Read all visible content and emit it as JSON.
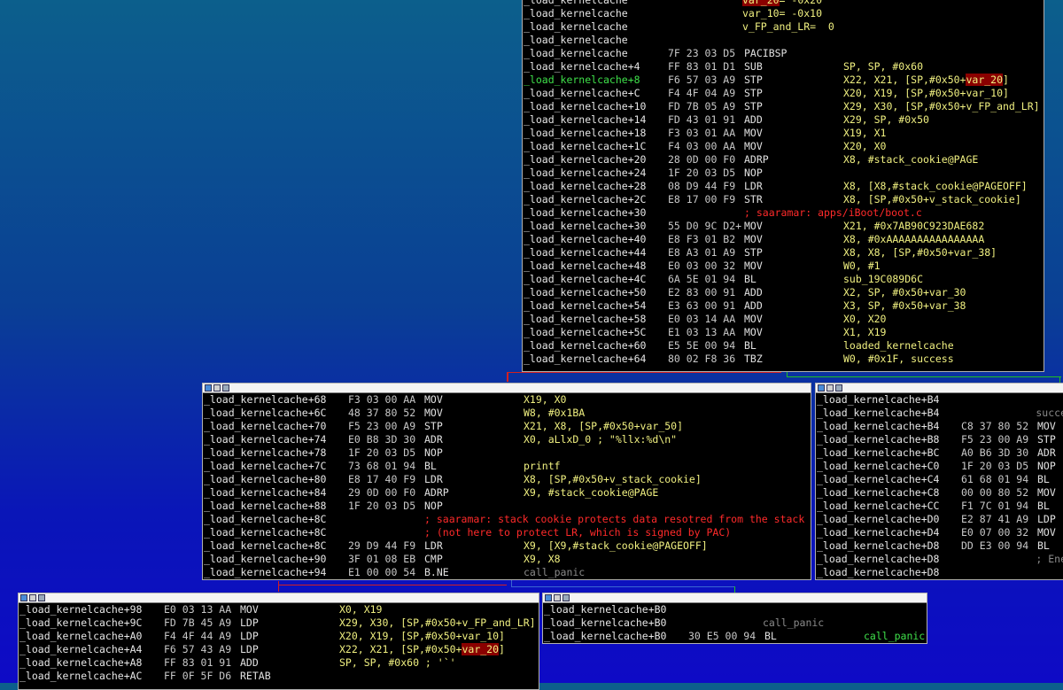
{
  "nodes": [
    {
      "id": "node-top",
      "title": false,
      "lines": [
        {
          "label": "_load_kernelcache",
          "hex": "",
          "mn": "",
          "ops": "var_20= -0x20",
          "cls": "op"
        },
        {
          "label": "_load_kernelcache",
          "hex": "",
          "mn": "",
          "ops": "var_10= -0x10",
          "cls": "op"
        },
        {
          "label": "_load_kernelcache",
          "hex": "",
          "mn": "",
          "ops": "v_FP_and_LR=  0",
          "cls": "op"
        },
        {
          "label": "_load_kernelcache",
          "hex": "",
          "mn": "",
          "ops": ""
        },
        {
          "label": "_load_kernelcache",
          "hex": "7F 23 03 D5",
          "mn": "PACIBSP",
          "ops": ""
        },
        {
          "label": "_load_kernelcache+4",
          "hex": "FF 83 01 D1",
          "mn": "SUB",
          "ops": "SP, SP, #0x60"
        },
        {
          "label": "_load_kernelcache+8",
          "hex": "F6 57 03 A9",
          "mn": "STP",
          "ops": "X22, X21, [SP,#0x50+var_20]",
          "green": true
        },
        {
          "label": "_load_kernelcache+C",
          "hex": "F4 4F 04 A9",
          "mn": "STP",
          "ops": "X20, X19, [SP,#0x50+var_10]"
        },
        {
          "label": "_load_kernelcache+10",
          "hex": "FD 7B 05 A9",
          "mn": "STP",
          "ops": "X29, X30, [SP,#0x50+v_FP_and_LR]"
        },
        {
          "label": "_load_kernelcache+14",
          "hex": "FD 43 01 91",
          "mn": "ADD",
          "ops": "X29, SP, #0x50"
        },
        {
          "label": "_load_kernelcache+18",
          "hex": "F3 03 01 AA",
          "mn": "MOV",
          "ops": "X19, X1"
        },
        {
          "label": "_load_kernelcache+1C",
          "hex": "F4 03 00 AA",
          "mn": "MOV",
          "ops": "X20, X0"
        },
        {
          "label": "_load_kernelcache+20",
          "hex": "28 0D 00 F0",
          "mn": "ADRP",
          "ops": "X8, #stack_cookie@PAGE"
        },
        {
          "label": "_load_kernelcache+24",
          "hex": "1F 20 03 D5",
          "mn": "NOP",
          "ops": ""
        },
        {
          "label": "_load_kernelcache+28",
          "hex": "08 D9 44 F9",
          "mn": "LDR",
          "ops": "X8, [X8,#stack_cookie@PAGEOFF]"
        },
        {
          "label": "_load_kernelcache+2C",
          "hex": "E8 17 00 F9",
          "mn": "STR",
          "ops": "X8, [SP,#0x50+v_stack_cookie]"
        },
        {
          "label": "_load_kernelcache+30",
          "hex": "",
          "mn": "",
          "ops": "; saaramar: apps/iBoot/boot.c",
          "comment": true
        },
        {
          "label": "_load_kernelcache+30",
          "hex": "55 D0 9C D2+",
          "mn": "MOV",
          "ops": "X21, #0x7AB90C923DAE682"
        },
        {
          "label": "_load_kernelcache+40",
          "hex": "E8 F3 01 B2",
          "mn": "MOV",
          "ops": "X8, #0xAAAAAAAAAAAAAAAA"
        },
        {
          "label": "_load_kernelcache+44",
          "hex": "E8 A3 01 A9",
          "mn": "STP",
          "ops": "X8, X8, [SP,#0x50+var_38]"
        },
        {
          "label": "_load_kernelcache+48",
          "hex": "E0 03 00 32",
          "mn": "MOV",
          "ops": "W0, #1"
        },
        {
          "label": "_load_kernelcache+4C",
          "hex": "6A 5E 01 94",
          "mn": "BL",
          "ops": "sub_19C089D6C"
        },
        {
          "label": "_load_kernelcache+50",
          "hex": "E2 83 00 91",
          "mn": "ADD",
          "ops": "X2, SP, #0x50+var_30"
        },
        {
          "label": "_load_kernelcache+54",
          "hex": "E3 63 00 91",
          "mn": "ADD",
          "ops": "X3, SP, #0x50+var_38"
        },
        {
          "label": "_load_kernelcache+58",
          "hex": "E0 03 14 AA",
          "mn": "MOV",
          "ops": "X0, X20"
        },
        {
          "label": "_load_kernelcache+5C",
          "hex": "E1 03 13 AA",
          "mn": "MOV",
          "ops": "X1, X19"
        },
        {
          "label": "_load_kernelcache+60",
          "hex": "E5 5E 00 94",
          "mn": "BL",
          "ops": "loaded_kernelcache"
        },
        {
          "label": "_load_kernelcache+64",
          "hex": "80 02 F8 36",
          "mn": "TBZ",
          "ops": "W0, #0x1F, success"
        }
      ]
    },
    {
      "id": "node-mid-left",
      "title": true,
      "lines": [
        {
          "label": "_load_kernelcache+68",
          "hex": "F3 03 00 AA",
          "mn": "MOV",
          "ops": "X19, X0"
        },
        {
          "label": "_load_kernelcache+6C",
          "hex": "48 37 80 52",
          "mn": "MOV",
          "ops": "W8, #0x1BA"
        },
        {
          "label": "_load_kernelcache+70",
          "hex": "F5 23 00 A9",
          "mn": "STP",
          "ops": "X21, X8, [SP,#0x50+var_50]"
        },
        {
          "label": "_load_kernelcache+74",
          "hex": "E0 B8 3D 30",
          "mn": "ADR",
          "ops": "X0, aLlxD_0 ; \"%llx:%d\\n\""
        },
        {
          "label": "_load_kernelcache+78",
          "hex": "1F 20 03 D5",
          "mn": "NOP",
          "ops": ""
        },
        {
          "label": "_load_kernelcache+7C",
          "hex": "73 68 01 94",
          "mn": "BL",
          "ops": "printf"
        },
        {
          "label": "_load_kernelcache+80",
          "hex": "E8 17 40 F9",
          "mn": "LDR",
          "ops": "X8, [SP,#0x50+v_stack_cookie]"
        },
        {
          "label": "_load_kernelcache+84",
          "hex": "29 0D 00 F0",
          "mn": "ADRP",
          "ops": "X9, #stack_cookie@PAGE"
        },
        {
          "label": "_load_kernelcache+88",
          "hex": "1F 20 03 D5",
          "mn": "NOP",
          "ops": ""
        },
        {
          "label": "_load_kernelcache+8C",
          "hex": "",
          "mn": "",
          "ops": "; saaramar: stack cookie protects data resotred from the stack",
          "comment": true
        },
        {
          "label": "_load_kernelcache+8C",
          "hex": "",
          "mn": "",
          "ops": "; (not here to protect LR, which is signed by PAC)",
          "comment": true
        },
        {
          "label": "_load_kernelcache+8C",
          "hex": "29 D9 44 F9",
          "mn": "LDR",
          "ops": "X9, [X9,#stack_cookie@PAGEOFF]"
        },
        {
          "label": "_load_kernelcache+90",
          "hex": "3F 01 08 EB",
          "mn": "CMP",
          "ops": "X9, X8"
        },
        {
          "label": "_load_kernelcache+94",
          "hex": "E1 00 00 54",
          "mn": "B.NE",
          "ops": "call_panic",
          "dimops": true
        }
      ]
    },
    {
      "id": "node-mid-right",
      "title": true,
      "lines": [
        {
          "label": "_load_kernelcache+B4",
          "hex": "",
          "mn": "",
          "ops": ""
        },
        {
          "label": "_load_kernelcache+B4",
          "hex": "",
          "mn": "",
          "ops": "",
          "tail": "succe"
        },
        {
          "label": "_load_kernelcache+B4",
          "hex": "C8 37 80 52",
          "mn": "MOV",
          "ops": ""
        },
        {
          "label": "_load_kernelcache+B8",
          "hex": "F5 23 00 A9",
          "mn": "STP",
          "ops": ""
        },
        {
          "label": "_load_kernelcache+BC",
          "hex": "A0 B6 3D 30",
          "mn": "ADR",
          "ops": ""
        },
        {
          "label": "_load_kernelcache+C0",
          "hex": "1F 20 03 D5",
          "mn": "NOP",
          "ops": ""
        },
        {
          "label": "_load_kernelcache+C4",
          "hex": "61 68 01 94",
          "mn": "BL",
          "ops": ""
        },
        {
          "label": "_load_kernelcache+C8",
          "hex": "00 00 80 52",
          "mn": "MOV",
          "ops": ""
        },
        {
          "label": "_load_kernelcache+CC",
          "hex": "F1 7C 01 94",
          "mn": "BL",
          "ops": ""
        },
        {
          "label": "_load_kernelcache+D0",
          "hex": "E2 87 41 A9",
          "mn": "LDP",
          "ops": ""
        },
        {
          "label": "_load_kernelcache+D4",
          "hex": "E0 07 00 32",
          "mn": "MOV",
          "ops": ""
        },
        {
          "label": "_load_kernelcache+D8",
          "hex": "DD E3 00 94",
          "mn": "BL",
          "ops": ""
        },
        {
          "label": "_load_kernelcache+D8",
          "hex": "",
          "mn": "",
          "ops": "",
          "tail": "; Ene"
        },
        {
          "label": "_load_kernelcache+D8",
          "hex": "",
          "mn": "",
          "ops": ""
        }
      ]
    },
    {
      "id": "node-bottom-left",
      "title": true,
      "lines": [
        {
          "label": "_load_kernelcache+98",
          "hex": "E0 03 13 AA",
          "mn": "MOV",
          "ops": "X0, X19"
        },
        {
          "label": "_load_kernelcache+9C",
          "hex": "FD 7B 45 A9",
          "mn": "LDP",
          "ops": "X29, X30, [SP,#0x50+v_FP_and_LR]"
        },
        {
          "label": "_load_kernelcache+A0",
          "hex": "F4 4F 44 A9",
          "mn": "LDP",
          "ops": "X20, X19, [SP,#0x50+var_10]"
        },
        {
          "label": "_load_kernelcache+A4",
          "hex": "F6 57 43 A9",
          "mn": "LDP",
          "ops": "X22, X21, [SP,#0x50+var_20]"
        },
        {
          "label": "_load_kernelcache+A8",
          "hex": "FF 83 01 91",
          "mn": "ADD",
          "ops": "SP, SP, #0x60 ; '`'"
        },
        {
          "label": "_load_kernelcache+AC",
          "hex": "FF 0F 5F D6",
          "mn": "RETAB",
          "ops": ""
        }
      ]
    },
    {
      "id": "node-bottom-right",
      "title": true,
      "lines": [
        {
          "label": "_load_kernelcache+B0",
          "hex": "",
          "mn": "",
          "ops": ""
        },
        {
          "label": "_load_kernelcache+B0",
          "hex": "",
          "mn": "",
          "ops": "call_panic",
          "dimops": true
        },
        {
          "label": "_load_kernelcache+B0",
          "hex": "30 E5 00 94",
          "mn": "BL",
          "ops": "",
          "tail": "call_panic",
          "tailgreen": true
        }
      ]
    }
  ]
}
